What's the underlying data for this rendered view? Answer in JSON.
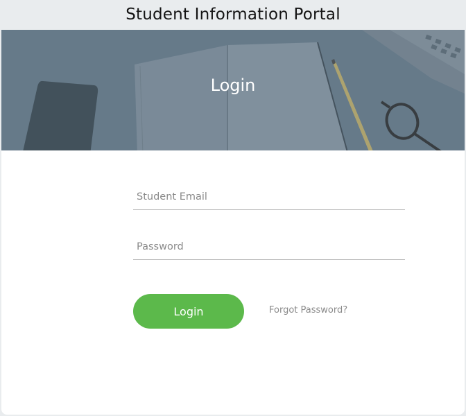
{
  "header": {
    "title": "Student Information Portal"
  },
  "hero": {
    "title": "Login"
  },
  "form": {
    "email": {
      "placeholder": "Student Email",
      "value": ""
    },
    "password": {
      "placeholder": "Password",
      "value": ""
    },
    "login_label": "Login",
    "forgot_label": "Forgot Password?"
  },
  "colors": {
    "accent_green": "#5cb94b",
    "hero_overlay": "#6a7e8d",
    "page_background": "#e9ecee"
  }
}
